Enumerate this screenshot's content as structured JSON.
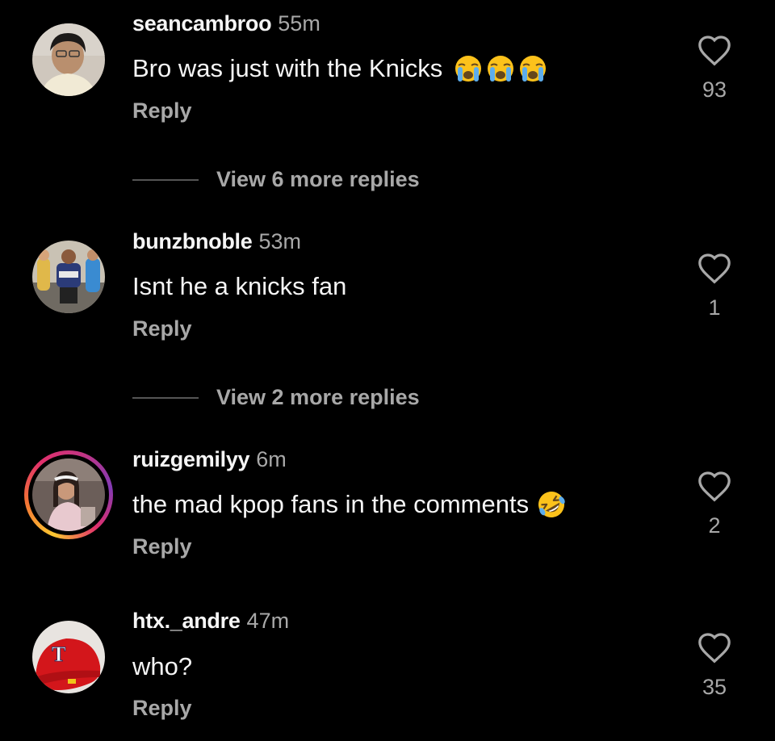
{
  "comments": [
    {
      "username": "seancambroo",
      "time": "55m",
      "text": "Bro was just with the Knicks",
      "emoji": [
        "loudly-crying-face",
        "loudly-crying-face",
        "loudly-crying-face"
      ],
      "reply_label": "Reply",
      "likes": "93",
      "view_more": "View 6 more replies"
    },
    {
      "username": "bunzbnoble",
      "time": "53m",
      "text": "Isnt he a knicks fan",
      "reply_label": "Reply",
      "likes": "1",
      "view_more": "View 2 more replies"
    },
    {
      "username": "ruizgemilyy",
      "time": "6m",
      "text": "the mad kpop fans in the comments",
      "emoji": [
        "rolling-on-floor-laughing"
      ],
      "reply_label": "Reply",
      "likes": "2",
      "has_story_ring": true
    },
    {
      "username": "htx._andre",
      "time": "47m",
      "text": "who?",
      "reply_label": "Reply",
      "likes": "35"
    }
  ],
  "colors": {
    "background": "#000000",
    "primary_text": "#f5f5f5",
    "secondary_text": "#a8a8a8",
    "story_ring": "#e1306c"
  }
}
